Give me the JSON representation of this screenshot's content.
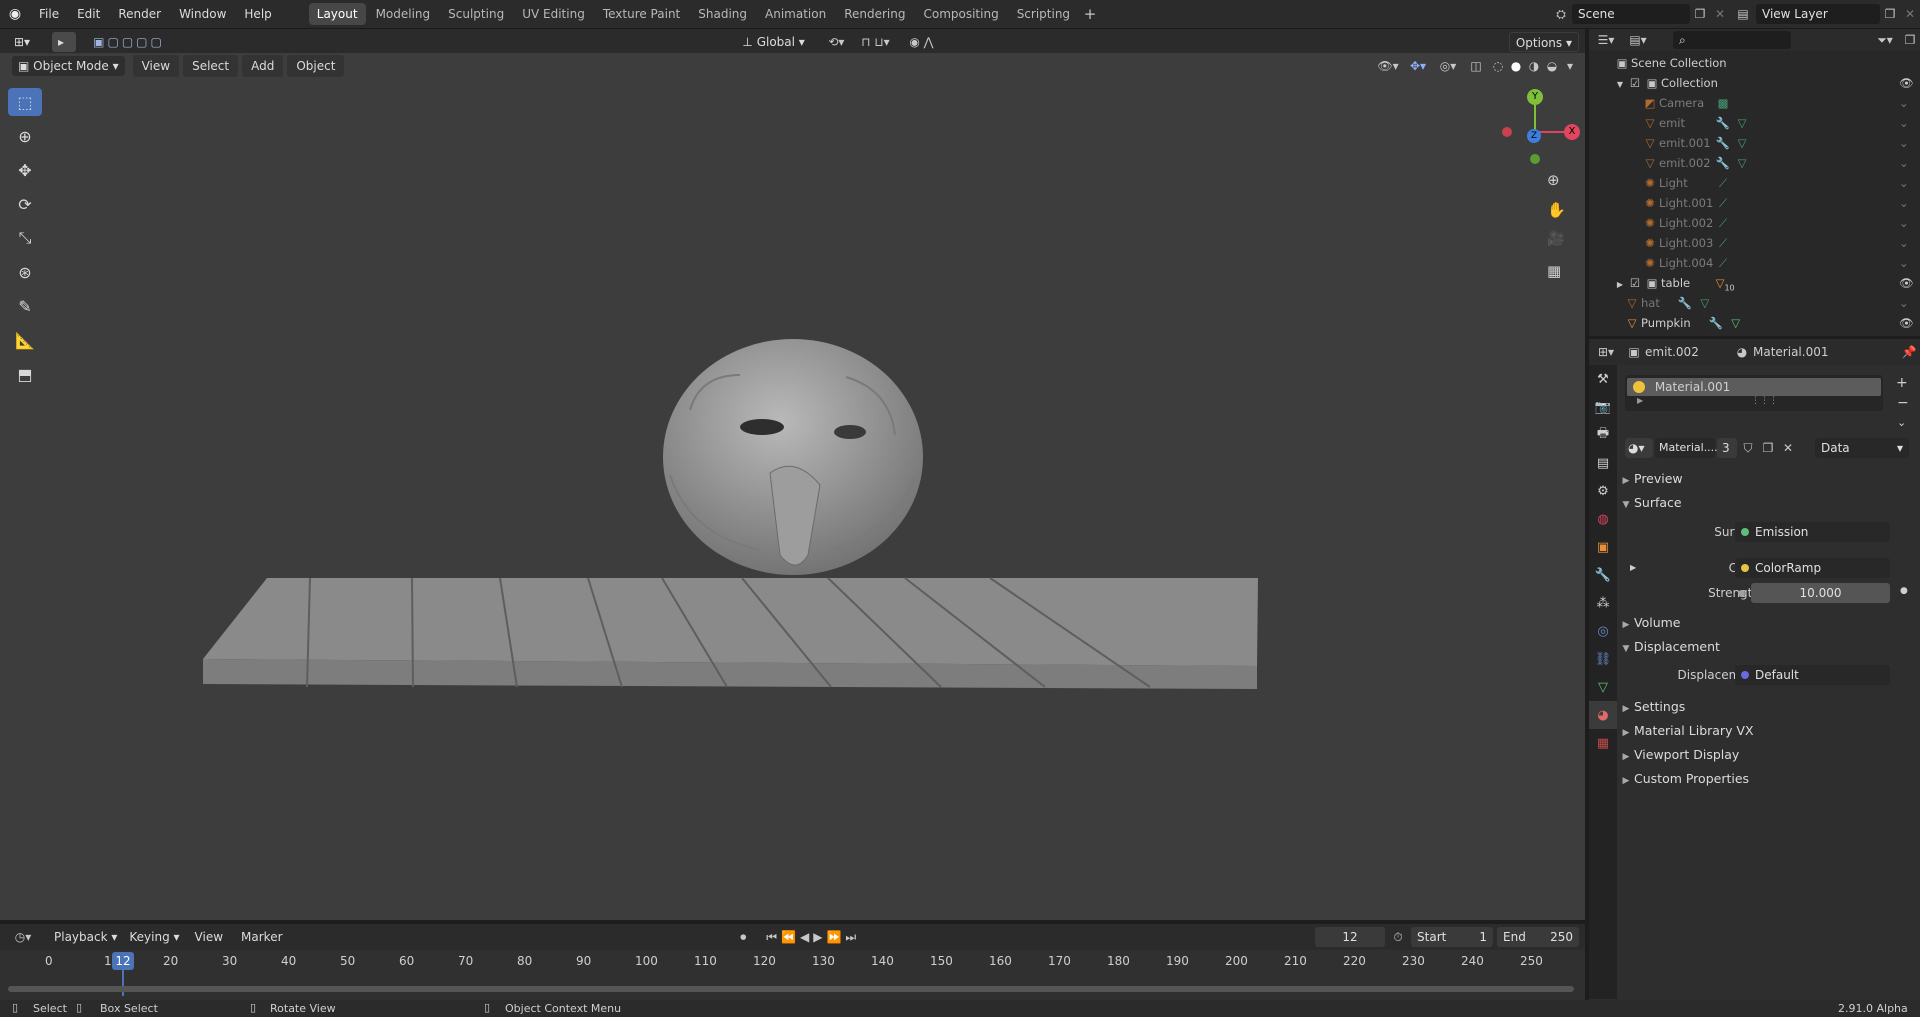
{
  "menu": {
    "file": "File",
    "edit": "Edit",
    "render": "Render",
    "window": "Window",
    "help": "Help"
  },
  "workspaces": [
    "Layout",
    "Modeling",
    "Sculpting",
    "UV Editing",
    "Texture Paint",
    "Shading",
    "Animation",
    "Rendering",
    "Compositing",
    "Scripting"
  ],
  "active_workspace": "Layout",
  "scene": {
    "name": "Scene",
    "view_layer": "View Layer"
  },
  "header": {
    "transform": "Global",
    "options": "Options"
  },
  "viewport_header": {
    "mode": "Object Mode",
    "view": "View",
    "select": "Select",
    "add": "Add",
    "object": "Object"
  },
  "gizmo": {
    "x": "X",
    "y": "Y",
    "z": "Z"
  },
  "outliner": {
    "root": "Scene Collection",
    "collection": "Collection",
    "items": [
      "Camera",
      "emit",
      "emit.001",
      "emit.002",
      "Light",
      "Light.001",
      "Light.002",
      "Light.003",
      "Light.004"
    ],
    "table": "table",
    "table_badge": "10",
    "hat": "hat",
    "pumpkin": "Pumpkin"
  },
  "properties": {
    "object": "emit.002",
    "material": "Material.001",
    "slot": "Material.001",
    "mat_short": "Material....",
    "users": "3",
    "link": "Data",
    "sections": {
      "preview": "Preview",
      "surface": "Surface",
      "volume": "Volume",
      "displacement": "Displacement",
      "settings": "Settings",
      "library": "Material Library VX",
      "viewport_display": "Viewport Display",
      "custom": "Custom Properties"
    },
    "surface_label": "Surface",
    "surface_value": "Emission",
    "color_label": "Color",
    "color_value": "ColorRamp",
    "strength_label": "Strength",
    "strength_value": "10.000",
    "disp_label": "Displacement",
    "disp_value": "Default"
  },
  "timeline": {
    "playback": "Playback",
    "keying": "Keying",
    "view": "View",
    "marker": "Marker",
    "current_frame": "12",
    "start_label": "Start",
    "start": "1",
    "end_label": "End",
    "end": "250",
    "ticks": [
      "0",
      "10",
      "20",
      "30",
      "40",
      "50",
      "60",
      "70",
      "80",
      "90",
      "100",
      "110",
      "120",
      "130",
      "140",
      "150",
      "160",
      "170",
      "180",
      "190",
      "200",
      "210",
      "220",
      "230",
      "240",
      "250"
    ]
  },
  "status": {
    "select": "Select",
    "box_select": "Box Select",
    "rotate": "Rotate View",
    "context": "Object Context Menu",
    "version": "2.91.0 Alpha"
  },
  "colors": {
    "accent": "#4a73b8",
    "orange": "#e88f3a",
    "green": "#5fbf7a",
    "panel": "#2e2e2e",
    "viewport": "#3d3d3d"
  }
}
